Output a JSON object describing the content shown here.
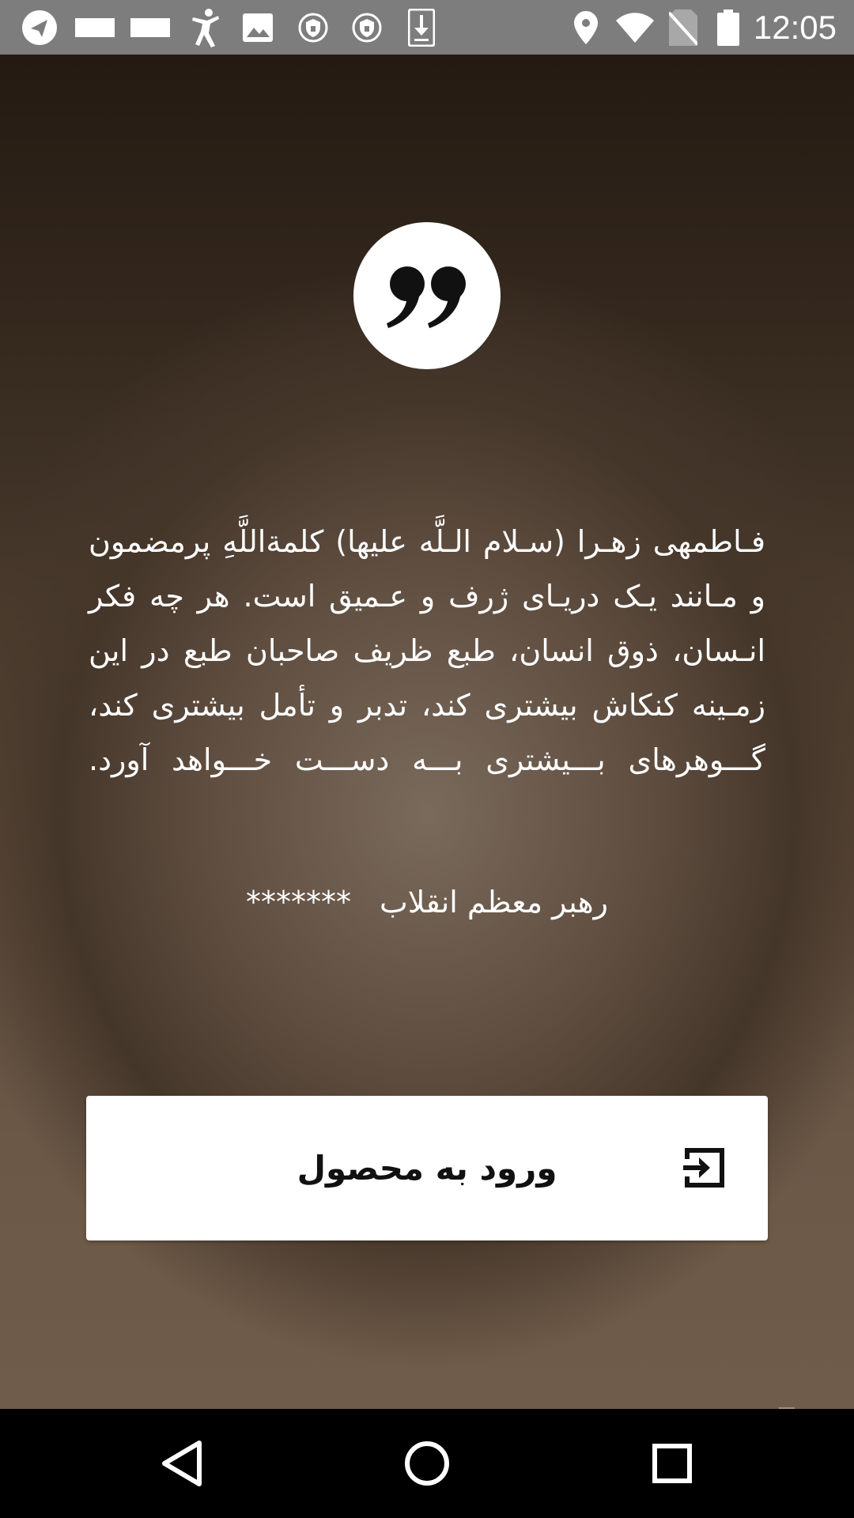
{
  "status_bar": {
    "time": "12:05",
    "left_icons": [
      "telegram-icon",
      "notification-bar-icon",
      "notification-bar-icon",
      "accessibility-icon",
      "image-icon",
      "vpn-shield-icon",
      "vpn-shield-icon",
      "download-icon"
    ],
    "right_icons": [
      "location-icon",
      "wifi-icon",
      "no-sim-icon",
      "battery-icon"
    ]
  },
  "quote": {
    "icon": "quote-icon",
    "text": "فـاطمهی زهـرا (سـلام الـلَّه علیها) کلمةاللَّهِ پرمضمون و مـانند یـک دریـای ژرف و عـمیق است. هر چه فکر انـسان، ذوق انسان، طبع ظریف صاحبان طبع در این زمـینه کنکاش بیشتری کند، تدبر و تأمل بیشتری کند، گـــوهرهای بـــیشتری بـــه دســـت خـــواهد آورد.",
    "author": "رهبر معظم انقلاب",
    "author_suffix": "*******"
  },
  "enter_button": {
    "label": "ورود به محصول",
    "icon": "exit-to-app-icon"
  },
  "nav_bar": {
    "back": "back-icon",
    "home": "home-icon",
    "recents": "recents-icon"
  },
  "colors": {
    "status_bar": "#7d7d7d",
    "nav_bar": "#000000",
    "background_top": "#241a12",
    "background_bottom": "#705c4a",
    "button": "#ffffff"
  }
}
